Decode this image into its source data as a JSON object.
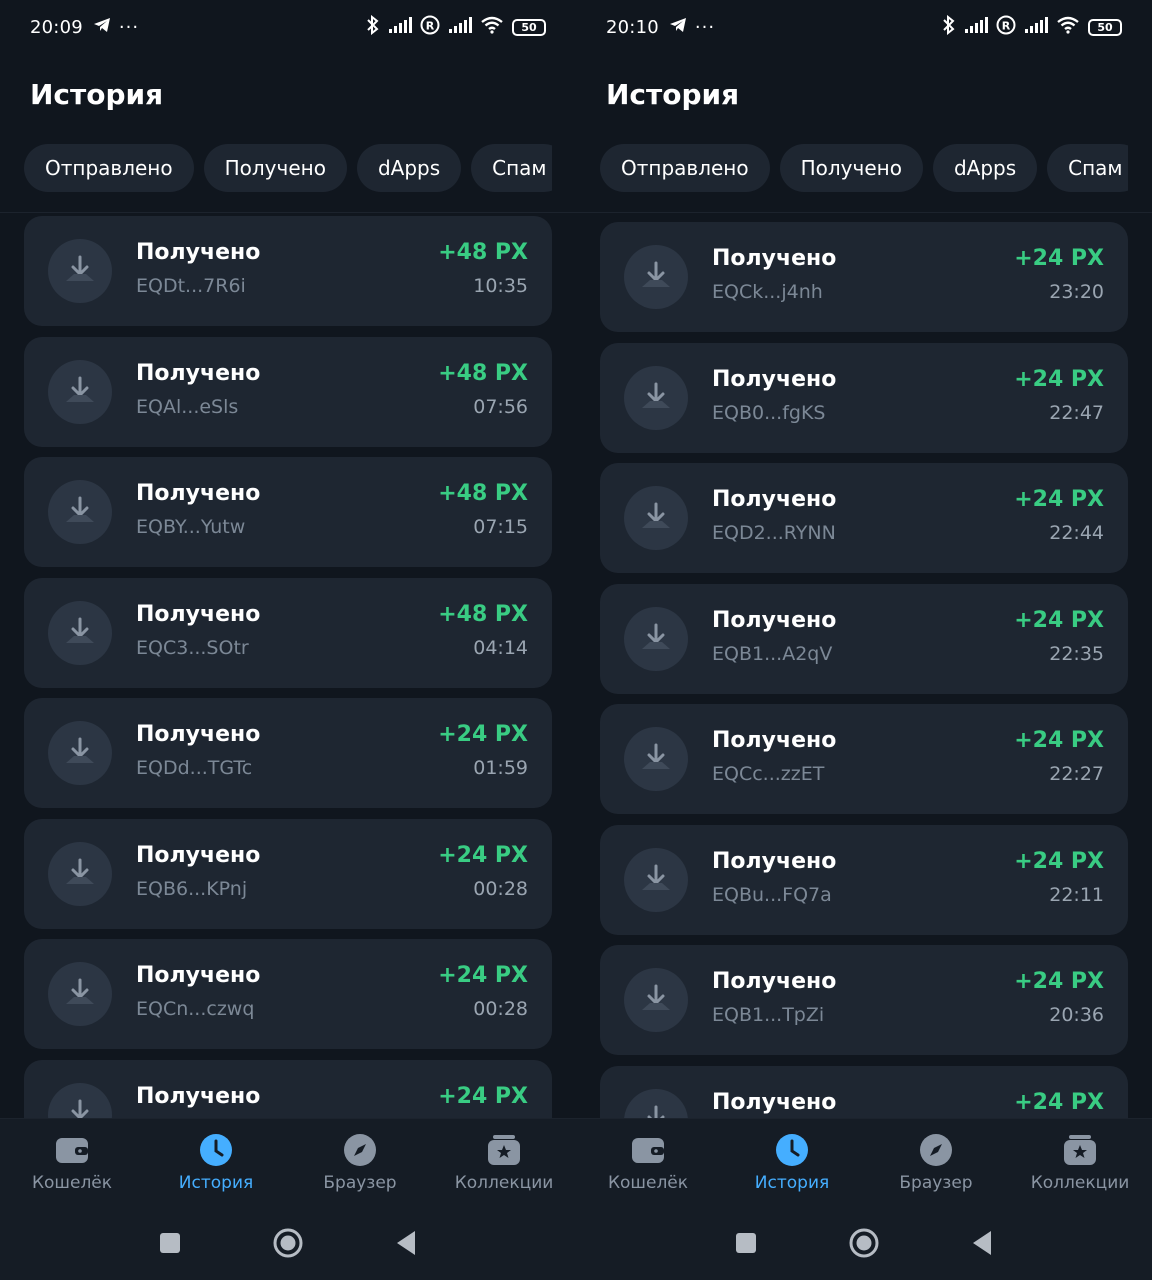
{
  "colors": {
    "background": "#10161e",
    "card": "#1e2631",
    "accent": "#45aeff",
    "positive": "#39cc83",
    "muted": "#7c8896"
  },
  "screens": [
    {
      "status": {
        "time": "20:09",
        "battery": "50"
      },
      "title": "История",
      "filters": [
        "Отправлено",
        "Получено",
        "dApps",
        "Спам"
      ],
      "transactions": [
        {
          "type": "Получено",
          "address": "EQDt...7R6i",
          "amount": "+48 PX",
          "time": "10:35"
        },
        {
          "type": "Получено",
          "address": "EQAl...eSls",
          "amount": "+48 PX",
          "time": "07:56"
        },
        {
          "type": "Получено",
          "address": "EQBY...Yutw",
          "amount": "+48 PX",
          "time": "07:15"
        },
        {
          "type": "Получено",
          "address": "EQC3...SOtr",
          "amount": "+48 PX",
          "time": "04:14"
        },
        {
          "type": "Получено",
          "address": "EQDd...TGTc",
          "amount": "+24 PX",
          "time": "01:59"
        },
        {
          "type": "Получено",
          "address": "EQB6...KPnj",
          "amount": "+24 PX",
          "time": "00:28"
        },
        {
          "type": "Получено",
          "address": "EQCn...czwq",
          "amount": "+24 PX",
          "time": "00:28"
        },
        {
          "type": "Получено",
          "address": "",
          "amount": "+24 PX",
          "time": ""
        }
      ],
      "tabs": [
        {
          "label": "Кошелёк",
          "icon": "wallet-icon"
        },
        {
          "label": "История",
          "icon": "clock-icon",
          "active": true
        },
        {
          "label": "Браузер",
          "icon": "compass-icon"
        },
        {
          "label": "Коллекции",
          "icon": "collection-star-icon"
        }
      ]
    },
    {
      "status": {
        "time": "20:10",
        "battery": "50"
      },
      "title": "История",
      "filters": [
        "Отправлено",
        "Получено",
        "dApps",
        "Спам"
      ],
      "transactions": [
        {
          "type": "Получено",
          "address": "EQCk...j4nh",
          "amount": "+24 PX",
          "time": "23:20"
        },
        {
          "type": "Получено",
          "address": "EQB0...fgKS",
          "amount": "+24 PX",
          "time": "22:47"
        },
        {
          "type": "Получено",
          "address": "EQD2...RYNN",
          "amount": "+24 PX",
          "time": "22:44"
        },
        {
          "type": "Получено",
          "address": "EQB1...A2qV",
          "amount": "+24 PX",
          "time": "22:35"
        },
        {
          "type": "Получено",
          "address": "EQCc...zzET",
          "amount": "+24 PX",
          "time": "22:27"
        },
        {
          "type": "Получено",
          "address": "EQBu...FQ7a",
          "amount": "+24 PX",
          "time": "22:11"
        },
        {
          "type": "Получено",
          "address": "EQB1...TpZi",
          "amount": "+24 PX",
          "time": "20:36"
        },
        {
          "type": "Получено",
          "address": "",
          "amount": "+24 PX",
          "time": ""
        }
      ],
      "tabs": [
        {
          "label": "Кошелёк",
          "icon": "wallet-icon"
        },
        {
          "label": "История",
          "icon": "clock-icon",
          "active": true
        },
        {
          "label": "Браузер",
          "icon": "compass-icon"
        },
        {
          "label": "Коллекции",
          "icon": "collection-star-icon"
        }
      ]
    }
  ]
}
